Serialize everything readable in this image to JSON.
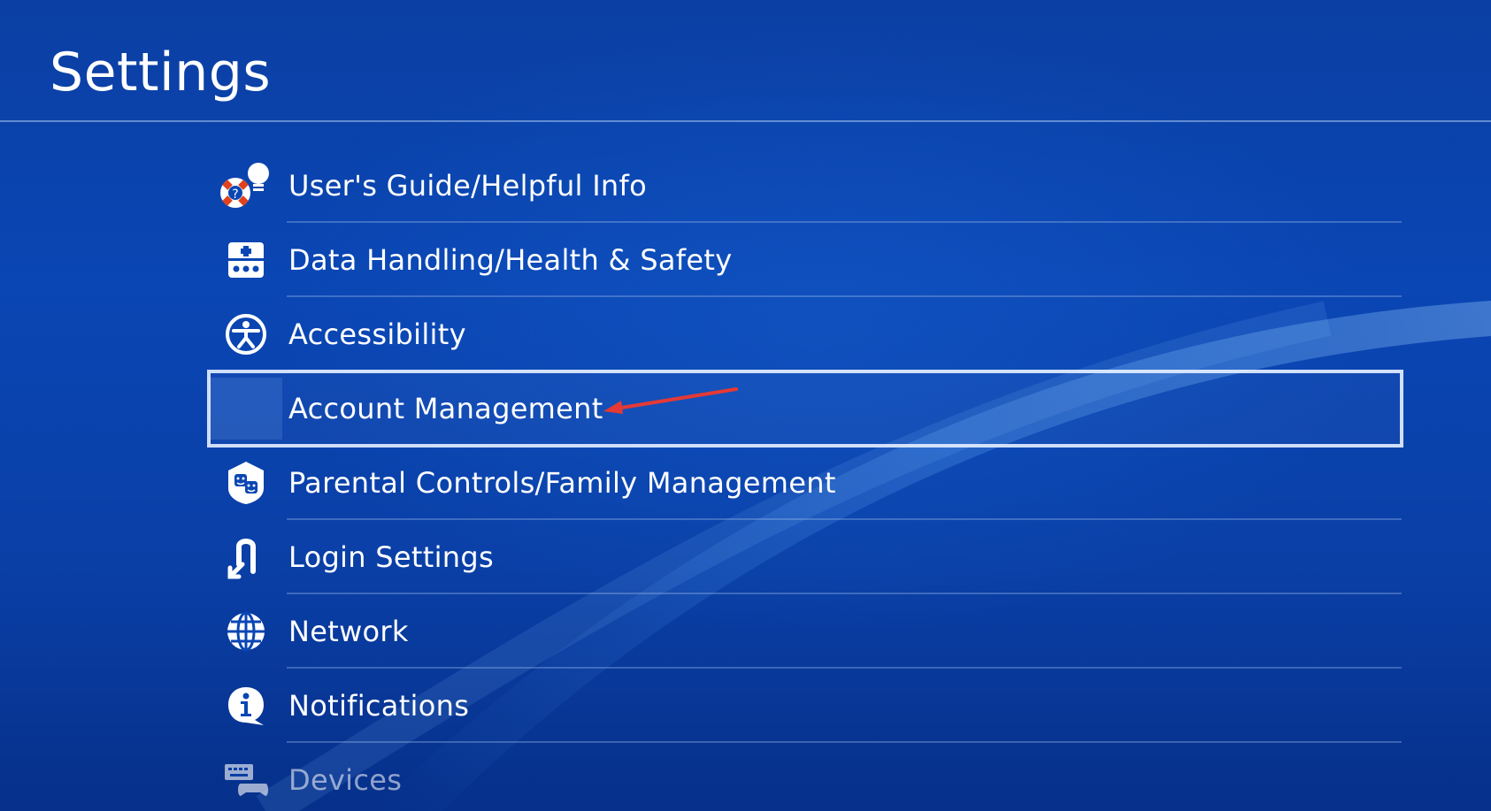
{
  "header": {
    "title": "Settings"
  },
  "menu": {
    "items": [
      {
        "label": "User's Guide/Helpful Info",
        "icon": "lifebuoy-lightbulb-icon"
      },
      {
        "label": "Data Handling/Health & Safety",
        "icon": "health-safety-icon"
      },
      {
        "label": "Accessibility",
        "icon": "accessibility-icon"
      },
      {
        "label": "Account Management",
        "icon": "account-icon",
        "selected": true
      },
      {
        "label": "Parental Controls/Family Management",
        "icon": "family-faces-icon"
      },
      {
        "label": "Login Settings",
        "icon": "login-arrow-icon"
      },
      {
        "label": "Network",
        "icon": "globe-icon"
      },
      {
        "label": "Notifications",
        "icon": "info-bubble-icon"
      },
      {
        "label": "Devices",
        "icon": "keyboard-controller-icon"
      }
    ]
  },
  "colors": {
    "background": "#0a46b4",
    "annotation_arrow": "#e53935",
    "selection_border": "#e6f0ff"
  }
}
